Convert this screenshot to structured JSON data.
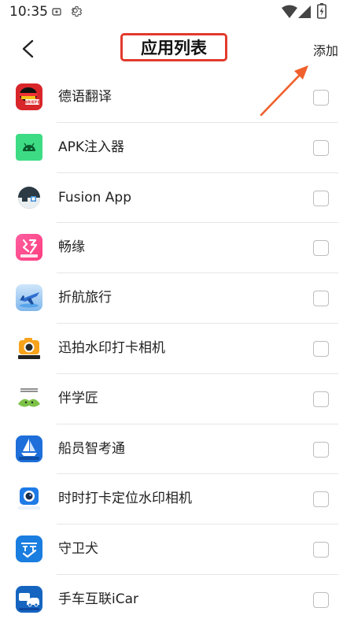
{
  "status_bar": {
    "time": "10:35",
    "icons": [
      "notification-icon",
      "settings-icon",
      "wifi-icon",
      "signal-icon",
      "battery-icon"
    ]
  },
  "header": {
    "back_icon": "chevron-left-icon",
    "title": "应用列表",
    "add_label": "添加",
    "highlight_color": "#e23a2c",
    "annotation_arrow_color": "#f0602c"
  },
  "apps": [
    {
      "name": "德语翻译",
      "icon": "german-translate-app-icon"
    },
    {
      "name": "APK注入器",
      "icon": "android-apk-app-icon"
    },
    {
      "name": "Fusion App",
      "icon": "fusion-app-icon"
    },
    {
      "name": "畅缘",
      "icon": "changyuan-app-icon"
    },
    {
      "name": "折航旅行",
      "icon": "zhehang-travel-app-icon"
    },
    {
      "name": "迅拍水印打卡相机",
      "icon": "camera-watermark-app-icon"
    },
    {
      "name": "伴学匠",
      "icon": "banxuejiang-app-icon"
    },
    {
      "name": "船员智考通",
      "icon": "sailor-exam-app-icon"
    },
    {
      "name": "时时打卡定位水印相机",
      "icon": "location-camera-app-icon"
    },
    {
      "name": "守卫犬",
      "icon": "guard-dog-app-icon"
    },
    {
      "name": "手车互联iCar",
      "icon": "icar-app-icon"
    }
  ]
}
